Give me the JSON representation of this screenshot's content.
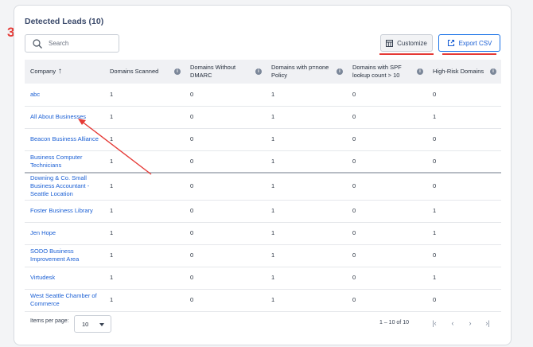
{
  "step_number": "3",
  "card": {
    "title": "Detected Leads (10)"
  },
  "search": {
    "placeholder": "Search"
  },
  "toolbar": {
    "customize_label": "Customize",
    "export_label": "Export CSV"
  },
  "table": {
    "columns": [
      {
        "label": "Company",
        "sort": "ascending",
        "has_info": false
      },
      {
        "label": "Domains Scanned",
        "has_info": true
      },
      {
        "label": "Domains Without DMARC",
        "has_info": true
      },
      {
        "label": "Domains with p=none Policy",
        "has_info": true
      },
      {
        "label": "Domains with SPF lookup count > 10",
        "has_info": true
      },
      {
        "label": "High-Risk Domains",
        "has_info": true
      }
    ],
    "rows": [
      {
        "company": "abc",
        "scanned": "1",
        "without_dmarc": "0",
        "p_none": "1",
        "spf_over_10": "0",
        "high_risk": "0"
      },
      {
        "company": "All About Businesses",
        "scanned": "1",
        "without_dmarc": "0",
        "p_none": "1",
        "spf_over_10": "0",
        "high_risk": "1"
      },
      {
        "company": "Beacon Business Alliance",
        "scanned": "1",
        "without_dmarc": "0",
        "p_none": "1",
        "spf_over_10": "0",
        "high_risk": "0"
      },
      {
        "company": "Business Computer Technicians",
        "scanned": "1",
        "without_dmarc": "0",
        "p_none": "1",
        "spf_over_10": "0",
        "high_risk": "0"
      },
      {
        "company": "Downing & Co. Small Business Accountant - Seattle Location",
        "scanned": "1",
        "without_dmarc": "0",
        "p_none": "1",
        "spf_over_10": "0",
        "high_risk": "0"
      },
      {
        "company": "Foster Business Library",
        "scanned": "1",
        "without_dmarc": "0",
        "p_none": "1",
        "spf_over_10": "0",
        "high_risk": "1"
      },
      {
        "company": "Jen Hope",
        "scanned": "1",
        "without_dmarc": "0",
        "p_none": "1",
        "spf_over_10": "0",
        "high_risk": "1"
      },
      {
        "company": "SODO Business Improvement Area",
        "scanned": "1",
        "without_dmarc": "0",
        "p_none": "1",
        "spf_over_10": "0",
        "high_risk": "0"
      },
      {
        "company": "Virtudesk",
        "scanned": "1",
        "without_dmarc": "0",
        "p_none": "1",
        "spf_over_10": "0",
        "high_risk": "1"
      },
      {
        "company": "West Seattle Chamber of Commerce",
        "scanned": "1",
        "without_dmarc": "0",
        "p_none": "1",
        "spf_over_10": "0",
        "high_risk": "0"
      }
    ]
  },
  "pagination": {
    "items_per_page_label": "Items per page:",
    "items_per_page_value": "10",
    "range_label": "1 – 10 of 10"
  },
  "colors": {
    "accent": "#1a73e8",
    "annotation": "#e53935",
    "link": "#1a5fd4"
  }
}
